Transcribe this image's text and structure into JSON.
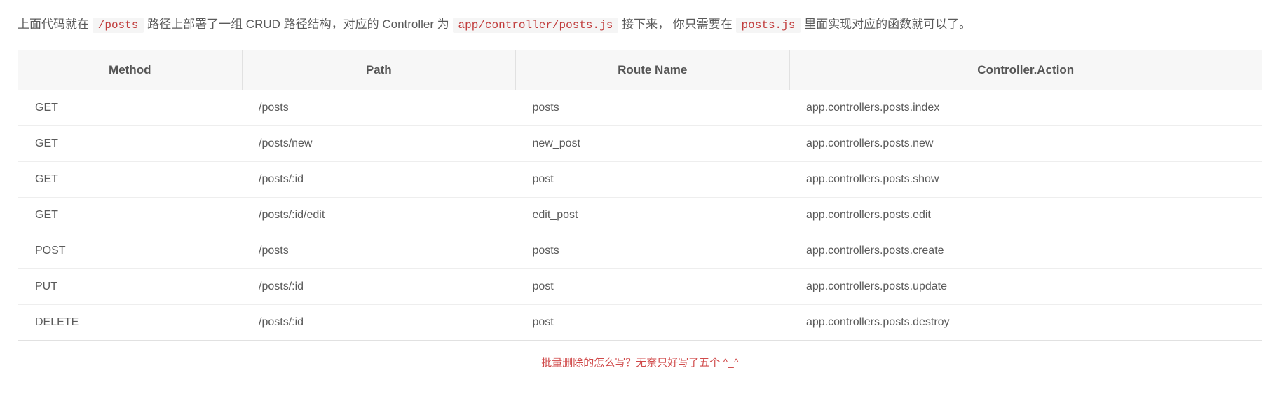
{
  "intro": {
    "part1": "上面代码就在 ",
    "code1": "/posts",
    "part2": " 路径上部署了一组 CRUD 路径结构，对应的 Controller 为 ",
    "code2": "app/controller/posts.js",
    "part3": " 接下来， 你只需要在 ",
    "code3": "posts.js",
    "part4": " 里面实现对应的函数就可以了。"
  },
  "table": {
    "headers": {
      "method": "Method",
      "path": "Path",
      "route_name": "Route Name",
      "controller_action": "Controller.Action"
    },
    "rows": [
      {
        "method": "GET",
        "path": "/posts",
        "route": "posts",
        "action": "app.controllers.posts.index"
      },
      {
        "method": "GET",
        "path": "/posts/new",
        "route": "new_post",
        "action": "app.controllers.posts.new"
      },
      {
        "method": "GET",
        "path": "/posts/:id",
        "route": "post",
        "action": "app.controllers.posts.show"
      },
      {
        "method": "GET",
        "path": "/posts/:id/edit",
        "route": "edit_post",
        "action": "app.controllers.posts.edit"
      },
      {
        "method": "POST",
        "path": "/posts",
        "route": "posts",
        "action": "app.controllers.posts.create"
      },
      {
        "method": "PUT",
        "path": "/posts/:id",
        "route": "post",
        "action": "app.controllers.posts.update"
      },
      {
        "method": "DELETE",
        "path": "/posts/:id",
        "route": "post",
        "action": "app.controllers.posts.destroy"
      }
    ]
  },
  "note": "批量删除的怎么写？无奈只好写了五个  ^_^"
}
